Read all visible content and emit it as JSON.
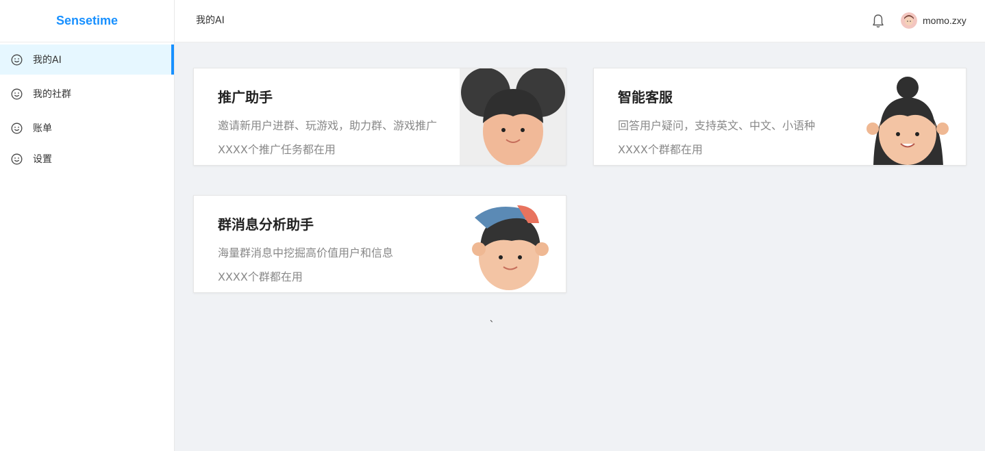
{
  "brand": "Sensetime",
  "menu": [
    {
      "label": "我的AI",
      "icon": "smile-icon",
      "active": true
    },
    {
      "label": "我的社群",
      "icon": "smile-icon"
    },
    {
      "label": "账单",
      "icon": "smile-icon"
    },
    {
      "label": "设置",
      "icon": "smile-icon"
    }
  ],
  "header": {
    "breadcrumb": "我的AI",
    "username": "momo.zxy",
    "bell_icon": "bell-icon"
  },
  "cards": [
    {
      "title": "推广助手",
      "desc": "邀请新用户进群、玩游戏，助力群、游戏推广",
      "stat": "XXXX个推广任务都在用",
      "image": "girl-buns-avatar"
    },
    {
      "title": "智能客服",
      "desc": "回答用户疑问，支持英文、中文、小语种",
      "stat": "XXXX个群都在用",
      "image": "girl-topknot-avatar"
    },
    {
      "title": "群消息分析助手",
      "desc": "海量群消息中挖掘高价值用户和信息",
      "stat": "XXXX个群都在用",
      "image": "boy-cap-avatar"
    }
  ],
  "stray_mark": "、",
  "colors": {
    "accent": "#1890ff",
    "active_bg": "#e6f7ff",
    "page_bg": "#f0f2f5"
  }
}
